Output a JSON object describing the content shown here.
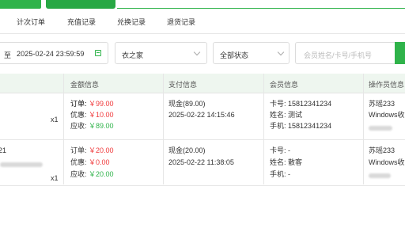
{
  "tabs": [
    "计次订单",
    "充值记录",
    "兑换记录",
    "退货记录"
  ],
  "filters": {
    "date_sep": "至",
    "date_end": "2025-02-24 23:59:59",
    "store": "衣之家",
    "status": "全部状态",
    "search_placeholder": "会员姓名/卡号/手机号"
  },
  "columns": {
    "amount": "金额信息",
    "payment": "支付信息",
    "member": "会员信息",
    "operator": "操作员信息"
  },
  "rows": [
    {
      "qty": "x1",
      "code": "",
      "amount": {
        "order_label": "订单:",
        "order": "￥99.00",
        "discount_label": "优惠:",
        "discount": "￥10.00",
        "due_label": "应收:",
        "due": "￥89.00"
      },
      "payment": {
        "method": "现金(89.00)",
        "time": "2025-02-22 14:15:46"
      },
      "member": {
        "card_label": "卡号:",
        "card": "15812341234",
        "name_label": "姓名:",
        "name": "测试",
        "phone_label": "手机:",
        "phone": "15812341234"
      },
      "operator": {
        "name": "苏瑶233",
        "device": "Windows收"
      }
    },
    {
      "qty": "x1",
      "code": "21",
      "amount": {
        "order_label": "订单:",
        "order": "￥20.00",
        "discount_label": "优惠:",
        "discount": "￥0.00",
        "due_label": "应收:",
        "due": "￥20.00"
      },
      "payment": {
        "method": "现金(20.00)",
        "time": "2025-02-22 11:38:05"
      },
      "member": {
        "card_label": "卡号:",
        "card": "-",
        "name_label": "姓名:",
        "name": "散客",
        "phone_label": "手机:",
        "phone": "-"
      },
      "operator": {
        "name": "苏瑶233",
        "device": "Windows收"
      }
    }
  ]
}
